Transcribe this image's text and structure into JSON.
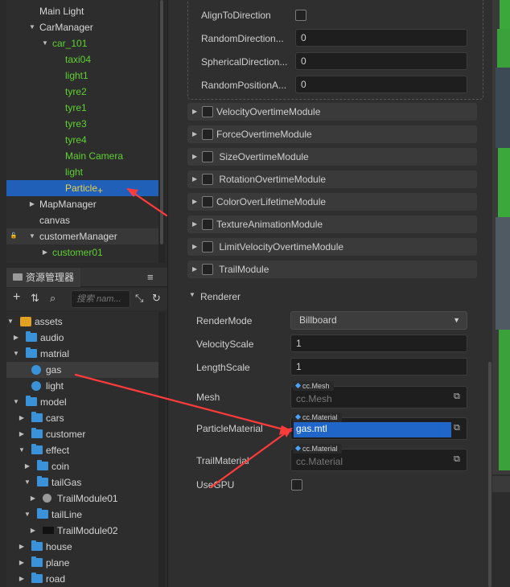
{
  "hierarchy": {
    "rows": [
      {
        "label": "Main Light",
        "indent": 49,
        "arrow": "",
        "color": "white"
      },
      {
        "label": "CarManager",
        "indent": 49,
        "arrow": "▼",
        "color": "white"
      },
      {
        "label": "car_101",
        "indent": 65,
        "arrow": "▼",
        "color": "green"
      },
      {
        "label": "taxi04",
        "indent": 81,
        "arrow": "",
        "color": "green"
      },
      {
        "label": "light1",
        "indent": 81,
        "arrow": "",
        "color": "green"
      },
      {
        "label": "tyre2",
        "indent": 81,
        "arrow": "",
        "color": "green"
      },
      {
        "label": "tyre1",
        "indent": 81,
        "arrow": "",
        "color": "green"
      },
      {
        "label": "tyre3",
        "indent": 81,
        "arrow": "",
        "color": "green"
      },
      {
        "label": "tyre4",
        "indent": 81,
        "arrow": "",
        "color": "green"
      },
      {
        "label": "Main Camera",
        "indent": 81,
        "arrow": "",
        "color": "green"
      },
      {
        "label": "light",
        "indent": 81,
        "arrow": "",
        "color": "green"
      },
      {
        "label": "Particle",
        "indent": 81,
        "arrow": "",
        "color": "green",
        "selected": true
      },
      {
        "label": "MapManager",
        "indent": 49,
        "arrow": "▶",
        "color": "white"
      },
      {
        "label": "canvas",
        "indent": 49,
        "arrow": "",
        "color": "white"
      },
      {
        "label": "customerManager",
        "indent": 49,
        "arrow": "▼",
        "color": "white",
        "dim": true
      },
      {
        "label": "customer01",
        "indent": 65,
        "arrow": "▶",
        "color": "green"
      }
    ]
  },
  "assets": {
    "tab_label": "资源管理器",
    "search_placeholder": "搜索 nam...",
    "rows": [
      {
        "label": "assets",
        "indent": 52,
        "arrow": "▼",
        "icon": "db"
      },
      {
        "label": "audio",
        "indent": 59,
        "arrow": "▶",
        "icon": "folder"
      },
      {
        "label": "matrial",
        "indent": 59,
        "arrow": "▼",
        "icon": "folder"
      },
      {
        "label": "gas",
        "indent": 66,
        "arrow": "",
        "icon": "material",
        "highlight": true
      },
      {
        "label": "light",
        "indent": 66,
        "arrow": "",
        "icon": "material"
      },
      {
        "label": "model",
        "indent": 59,
        "arrow": "▼",
        "icon": "folder"
      },
      {
        "label": "cars",
        "indent": 66,
        "arrow": "▶",
        "icon": "folder"
      },
      {
        "label": "customer",
        "indent": 66,
        "arrow": "▶",
        "icon": "folder"
      },
      {
        "label": "effect",
        "indent": 66,
        "arrow": "▼",
        "icon": "folder"
      },
      {
        "label": "coin",
        "indent": 73,
        "arrow": "▶",
        "icon": "folder"
      },
      {
        "label": "tailGas",
        "indent": 73,
        "arrow": "▼",
        "icon": "folder"
      },
      {
        "label": "TrailModule01",
        "indent": 80,
        "arrow": "▶",
        "icon": "prefab"
      },
      {
        "label": "tailLine",
        "indent": 73,
        "arrow": "▼",
        "icon": "folder"
      },
      {
        "label": "TrailModule02",
        "indent": 80,
        "arrow": "▶",
        "icon": "black"
      },
      {
        "label": "house",
        "indent": 66,
        "arrow": "▶",
        "icon": "folder"
      },
      {
        "label": "plane",
        "indent": 66,
        "arrow": "▶",
        "icon": "folder"
      },
      {
        "label": "road",
        "indent": 66,
        "arrow": "▶",
        "icon": "folder"
      }
    ]
  },
  "inspector": {
    "shape_props": [
      {
        "label": "AlignToDirection",
        "type": "checkbox"
      },
      {
        "label": "RandomDirection...",
        "type": "number",
        "value": "0"
      },
      {
        "label": "SphericalDirection...",
        "type": "number",
        "value": "0"
      },
      {
        "label": "RandomPositionA...",
        "type": "number",
        "value": "0"
      }
    ],
    "modules": [
      "VelocityOvertimeModule",
      "ForceOvertimeModule",
      " SizeOvertimeModule",
      " RotationOvertimeModule",
      "ColorOverLifetimeModule",
      "TextureAnimationModule",
      " LimitVelocityOvertimeModule",
      " TrailModule"
    ],
    "renderer": {
      "title": "Renderer",
      "render_mode_label": "RenderMode",
      "render_mode_value": "Billboard",
      "velocity_scale_label": "VelocityScale",
      "velocity_scale_value": "1",
      "length_scale_label": "LengthScale",
      "length_scale_value": "1",
      "mesh_label": "Mesh",
      "mesh_type": "cc.Mesh",
      "mesh_value": "cc.Mesh",
      "particle_material_label": "ParticleMaterial",
      "particle_material_type": "cc.Material",
      "particle_material_value": "gas.mtl",
      "trail_material_label": "TrailMaterial",
      "trail_material_type": "cc.Material",
      "trail_material_value": "cc.Material",
      "use_gpu_label": "UseGPU"
    }
  },
  "colors": {
    "selection": "#2160b8",
    "node_green": "#5fd12f",
    "annotation_red": "#ff3b3b"
  }
}
